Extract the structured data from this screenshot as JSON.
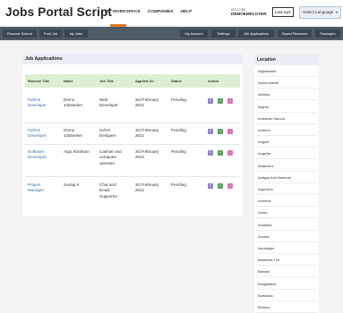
{
  "header": {
    "logo": "Jobs Portal Script",
    "nav": [
      "MY WORKSPACE",
      "COMPANIES",
      "HELP"
    ],
    "welcome": "WELCOME",
    "username": "DEMOEMPLOYER",
    "logout": "LOG OUT",
    "language": "Select Language"
  },
  "toolbar": {
    "left": [
      "Resume Search",
      "Post Job",
      "My Jobs"
    ],
    "right": [
      "My Account",
      "Settings",
      "Job Applications",
      "Saved Resumes",
      "Packages"
    ]
  },
  "applications": {
    "title": "Job Applications",
    "columns": [
      "Resume Title",
      "Name",
      "Job Title",
      "Applied On",
      "Status",
      "Action"
    ],
    "rows": [
      {
        "resume": [
          "Python",
          "Developer"
        ],
        "name": [
          "Demo",
          "Jobseeker"
        ],
        "job": [
          "Web",
          "Developer"
        ],
        "date": [
          "3rd February",
          "2021"
        ],
        "status": "Pending"
      },
      {
        "resume": [
          "Python",
          "Developer"
        ],
        "name": [
          "Demo",
          "Jobseeker"
        ],
        "job": [
          "UI/UX",
          "Designer"
        ],
        "date": [
          "3rd February",
          "2021"
        ],
        "status": "Pending"
      },
      {
        "resume": [
          "Software",
          "Developer"
        ],
        "name": [
          "Alga Abraham"
        ],
        "job": [
          "Cashier and",
          "computer",
          "operator"
        ],
        "date": [
          "3rd February",
          "2021"
        ],
        "status": "Pending"
      },
      {
        "resume": [
          "Project",
          "Manager"
        ],
        "name": [
          "Suraaj K"
        ],
        "job": [
          "Chat and",
          "Email",
          "Supporter"
        ],
        "date": [
          "3rd February",
          "2021"
        ],
        "status": "Pending"
      }
    ]
  },
  "location": {
    "title": "Location",
    "items": [
      "Afghanistan",
      "Aland Islands",
      "Albania",
      "Algeria",
      "American Samoa",
      "Andorra",
      "Angola",
      "Anguilla",
      "Antarctica",
      "Antigua And Barbuda",
      "Argentina",
      "Armenia",
      "Aruba",
      "Australia",
      "Austria",
      "Azerbaijan",
      "Bahamas The",
      "Bahrain",
      "Bangladesh",
      "Barbados",
      "Belarus"
    ]
  }
}
